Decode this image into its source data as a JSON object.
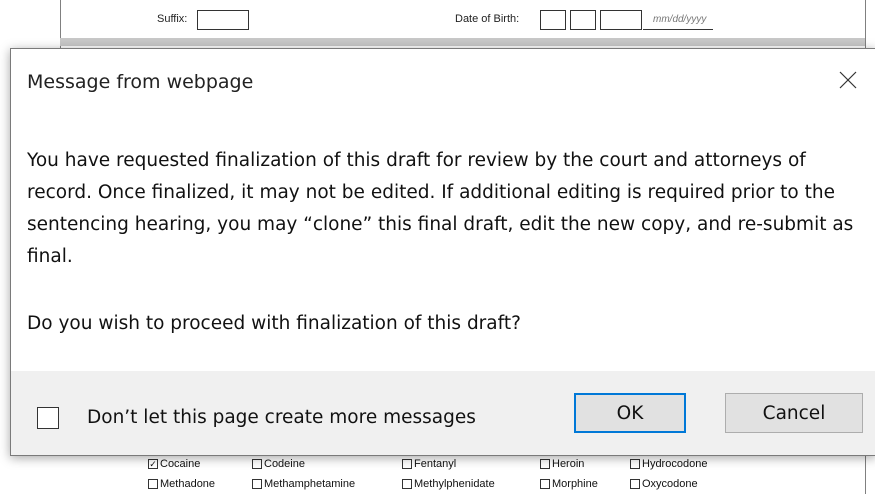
{
  "background_form": {
    "suffix_label": "Suffix:",
    "dob_label": "Date of Birth:",
    "dob_placeholder": "mm/dd/yyyy",
    "drugs_row1": [
      {
        "label": "Cocaine",
        "checked": true
      },
      {
        "label": "Codeine",
        "checked": false
      },
      {
        "label": "Fentanyl",
        "checked": false
      },
      {
        "label": "Heroin",
        "checked": false
      },
      {
        "label": "Hydrocodone",
        "checked": false
      }
    ],
    "drugs_row2": [
      {
        "label": "Methadone",
        "checked": false
      },
      {
        "label": "Methamphetamine",
        "checked": false
      },
      {
        "label": "Methylphenidate",
        "checked": false
      },
      {
        "label": "Morphine",
        "checked": false
      },
      {
        "label": "Oxycodone",
        "checked": false
      }
    ]
  },
  "dialog": {
    "title": "Message from webpage",
    "close_icon": "close-icon",
    "body": "You have requested finalization of this draft for review by the court and attorneys of record.  Once finalized, it may not be edited. If additional editing is required prior to the sentencing hearing, you may “clone” this final draft, edit the new copy, and re-submit as final.",
    "question": "Do you wish to proceed with finalization of this draft?",
    "suppress_label": "Don’t let this page create more messages",
    "suppress_checked": false,
    "ok_label": "OK",
    "cancel_label": "Cancel",
    "colors": {
      "focus_border": "#0078d7",
      "footer_bg": "#f0f0f0",
      "button_bg": "#e1e1e1"
    }
  }
}
